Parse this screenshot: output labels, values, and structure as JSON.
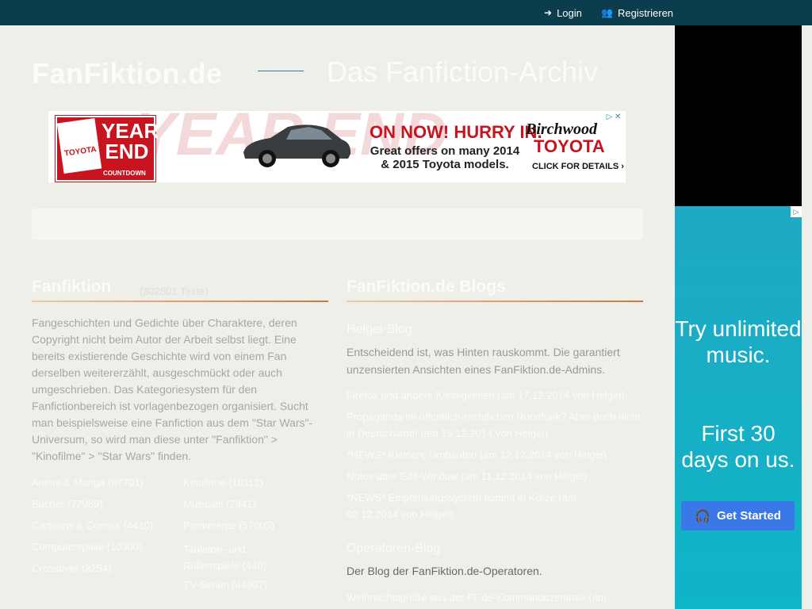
{
  "topbar": {
    "login": "Login",
    "register": "Registrieren",
    "login_icon": "sign-in-icon",
    "register_icon": "users-icon"
  },
  "header": {
    "logo": "FanFiktion.de",
    "tagline": "Das Fanfiction-Archiv"
  },
  "banner_ad": {
    "badge_title": "YEAR END",
    "badge_sub": "COUNTDOWN",
    "badge_brand": "TOYOTA",
    "headline": "ON NOW! HURRY IN.",
    "body": "Great offers on many 2014 & 2015 Toyota models.",
    "dealer": "Birchwood",
    "brand": "TOYOTA",
    "cta": "CLICK FOR DETAILS ›",
    "adchoices": "▷ ✕"
  },
  "fanfiktion": {
    "heading": "Fanfiktion",
    "count": "(302801 Texte)",
    "description": "Fangeschichten und Gedichte über Charaktere, deren Copyright nicht beim Autor der Arbeit selbst liegt. Eine bereits existierende Geschichte wird von einem Fan derselben weitererzählt, ausgeschmückt oder auch umgeschrieben. Das Kategoriesystem für den Fanfictionbereich ist vorlagenbezogen organisiert. Sucht man beispielsweise eine Fanfiction aus dem \"Star Wars\"-Universum, so wird man diese unter \"Fanfiktion\" > \"Kinofilme\" > \"Star Wars\" finden.",
    "categories_left": [
      "Anime & Manga (87701)",
      "Bücher (77989)",
      "Cartoons & Comics (4410)",
      "Computerspiele (10300)",
      "Crossover (3254)"
    ],
    "categories_right": [
      "Kinofilme (10112)",
      "Musicals (2341)",
      "Prominente (57005)",
      "Tabletop- und Rollenspiele (440)",
      "TV-Serien (44907)"
    ]
  },
  "blogs": {
    "heading": "FanFiktion.de Blogs",
    "helgei_title": "Helgei-Blog",
    "helgei_desc": "Entscheidend ist, was Hinten rauskommt. Die garantiert unzensierten Ansichten eines FanFiktion.de-Admins.",
    "helgei_posts": [
      "Firefox und andere Kleinigkeiten (am 17.12.2014 von Helgei)",
      "Propaganda im öffentlich-rechtlichen Rundfunk? Aber doch nicht in Deutschland! (am 15.12.2014 von Helgei)",
      "*NEWS* Kleinere Umbauten (am 12.12.2014 von Helgei)",
      "Notes über Edit-Window (am 11.12.2014 von Helgei)",
      "*NEWS* Empfehlungssystem kommt in Kürze (am 02.12.2014 von Helgei)"
    ],
    "operator_title": "Operatoren-Blog",
    "operator_desc": "Der Blog der FanFiktion.de-Operatoren.",
    "operator_posts": [
      "Weihnachtsgrüße aus der FF.de-Kommandozentrale (am"
    ]
  },
  "side_ad": {
    "try": "Try unlimited music.",
    "first": "First 30 days on us.",
    "button": "Get Started",
    "button_icon": "headphones-icon"
  }
}
